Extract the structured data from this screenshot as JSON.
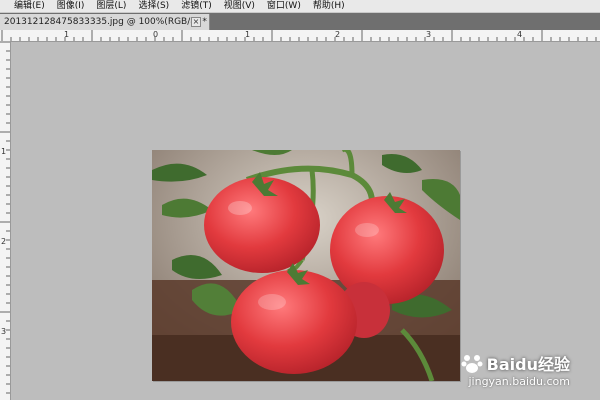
{
  "menubar": {
    "items": [
      {
        "label": "编辑(E)"
      },
      {
        "label": "图像(I)"
      },
      {
        "label": "图层(L)"
      },
      {
        "label": "选择(S)"
      },
      {
        "label": "滤镜(T)"
      },
      {
        "label": "视图(V)"
      },
      {
        "label": "窗口(W)"
      },
      {
        "label": "帮助(H)"
      }
    ]
  },
  "document_tab": {
    "title": "201312128475833335.jpg @ 100%(RGB/8) *",
    "close_glyph": "×"
  },
  "ruler_top": {
    "labels": [
      "1",
      "0",
      "1",
      "2",
      "3",
      "4"
    ]
  },
  "ruler_left": {
    "labels": [
      "1",
      "2",
      "3"
    ]
  },
  "watermark": {
    "logo_text": "Baidu经验",
    "url": "jingyan.baidu.com"
  },
  "colors": {
    "tomato": "#e23a3e",
    "leaf": "#3f6b2e",
    "soil": "#5a3a2a"
  }
}
